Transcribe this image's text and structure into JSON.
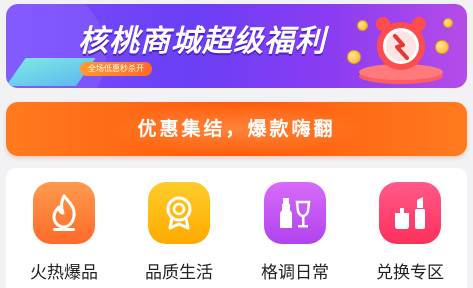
{
  "banner": {
    "title": "核桃商城超级福利",
    "pill": "全场低惠秒杀开"
  },
  "notice": {
    "text": "优惠集结，爆款嗨翻"
  },
  "categories": [
    {
      "label": "火热爆品",
      "color": "#ff7a2c"
    },
    {
      "label": "品质生活",
      "color": "#ffb400"
    },
    {
      "label": "格调日常",
      "color": "#c64ff2"
    },
    {
      "label": "兑换专区",
      "color": "#ff3a6a"
    }
  ]
}
